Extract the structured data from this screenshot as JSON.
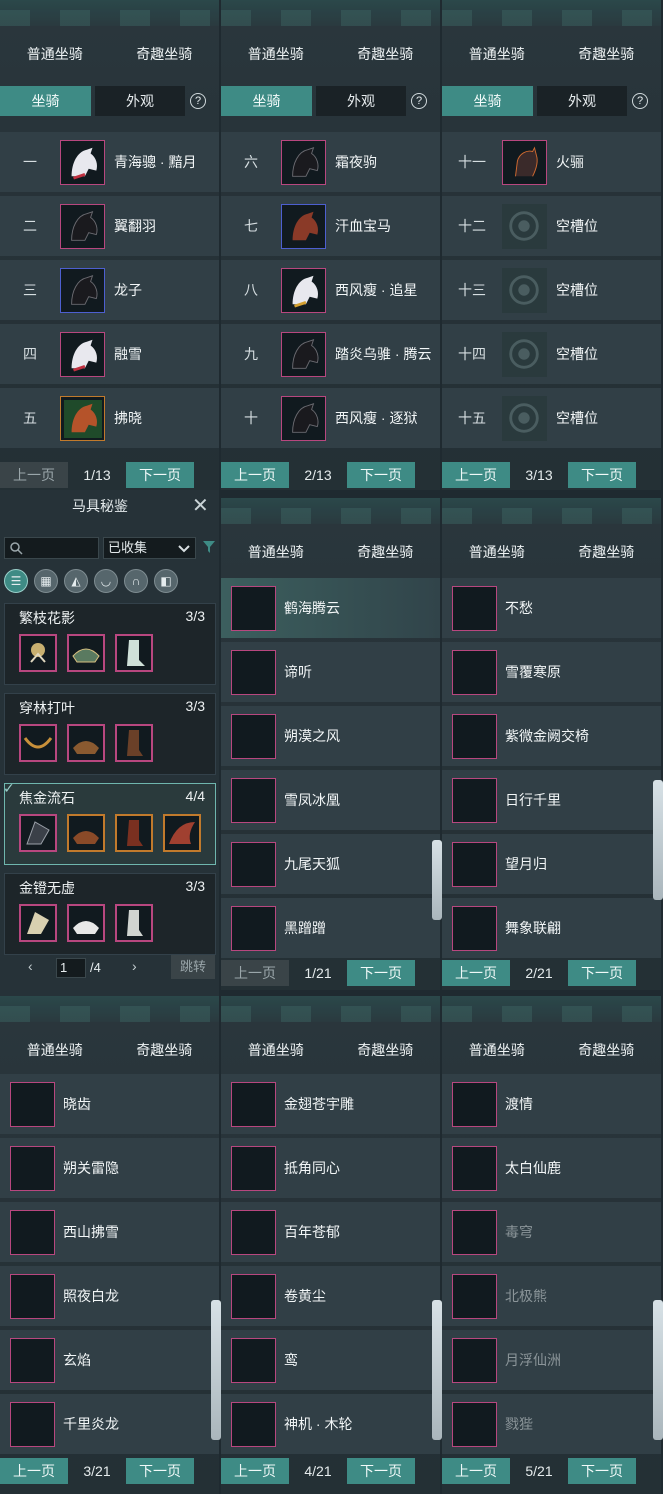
{
  "tabs": {
    "normal": "普通坐骑",
    "fun": "奇趣坐骑"
  },
  "subtabs": {
    "mount": "坐骑",
    "appearance": "外观",
    "help": "?"
  },
  "pager": {
    "prev": "上一页",
    "next": "下一页"
  },
  "p1": {
    "page": "1/13",
    "rows": [
      {
        "num": "一",
        "name": "青海骢 · 黯月"
      },
      {
        "num": "二",
        "name": "翼翻羽"
      },
      {
        "num": "三",
        "name": "龙子"
      },
      {
        "num": "四",
        "name": "融雪"
      },
      {
        "num": "五",
        "name": "拂晓"
      }
    ]
  },
  "p2": {
    "page": "2/13",
    "rows": [
      {
        "num": "六",
        "name": "霜夜驹"
      },
      {
        "num": "七",
        "name": "汗血宝马"
      },
      {
        "num": "八",
        "name": "西风瘦 · 追星"
      },
      {
        "num": "九",
        "name": "踏炎乌骓 · 腾云"
      },
      {
        "num": "十",
        "name": "西风瘦 · 逐狱"
      }
    ]
  },
  "p3": {
    "page": "3/13",
    "rows": [
      {
        "num": "十一",
        "name": "火骊"
      },
      {
        "num": "十二",
        "name": "空槽位"
      },
      {
        "num": "十三",
        "name": "空槽位"
      },
      {
        "num": "十四",
        "name": "空槽位"
      },
      {
        "num": "十五",
        "name": "空槽位"
      }
    ]
  },
  "coll": {
    "title": "马具秘鉴",
    "close": "✕",
    "filter_value": "已收集",
    "sets": [
      {
        "name": "繁枝花影",
        "count": "3/3"
      },
      {
        "name": "穿林打叶",
        "count": "3/3"
      },
      {
        "name": "焦金流石",
        "count": "4/4"
      },
      {
        "name": "金镫无虚",
        "count": "3/3"
      }
    ],
    "page_value": "1",
    "page_total": "/4",
    "jump": "跳转"
  },
  "p5": {
    "page": "1/21",
    "rows": [
      "鹤海腾云",
      "谛听",
      "朔漠之风",
      "雪凤冰凰",
      "九尾天狐",
      "黑蹭蹭"
    ]
  },
  "p6": {
    "page": "2/21",
    "rows": [
      "不愁",
      "雪覆寒原",
      "紫微金阙交椅",
      "日行千里",
      "望月归",
      "舞象联翩"
    ]
  },
  "p7": {
    "page": "3/21",
    "rows": [
      "晓齿",
      "朔关雷隐",
      "西山拂雪",
      "照夜白龙",
      "玄焰",
      "千里炎龙"
    ]
  },
  "p8": {
    "page": "4/21",
    "rows": [
      "金翅苍宇雕",
      "抵角同心",
      "百年苍郁",
      "卷黄尘",
      "鸾",
      "神机 · 木轮"
    ]
  },
  "p9": {
    "page": "5/21",
    "rows": [
      "渡情",
      "太白仙鹿",
      "毒穹",
      "北极熊",
      "月浮仙洲",
      "戮狴"
    ]
  }
}
